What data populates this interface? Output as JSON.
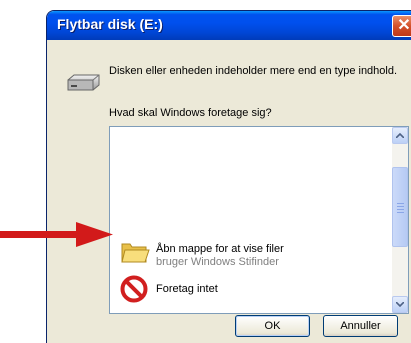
{
  "window": {
    "title": "Flytbar disk (E:)"
  },
  "dialog": {
    "message": "Disken eller enheden indeholder mere end en type indhold.",
    "question": "Hvad skal Windows foretage sig?"
  },
  "options": [
    {
      "label": "Åbn mappe for at vise filer",
      "sub": "bruger Windows Stifinder",
      "icon": "folder-icon"
    },
    {
      "label": "Foretag intet",
      "icon": "no-action-icon"
    }
  ],
  "buttons": {
    "ok": "OK",
    "cancel": "Annuller"
  },
  "colors": {
    "titlebar": "#0053ee",
    "arrow": "#d21a1a",
    "dialog_bg": "#ece9d8"
  }
}
